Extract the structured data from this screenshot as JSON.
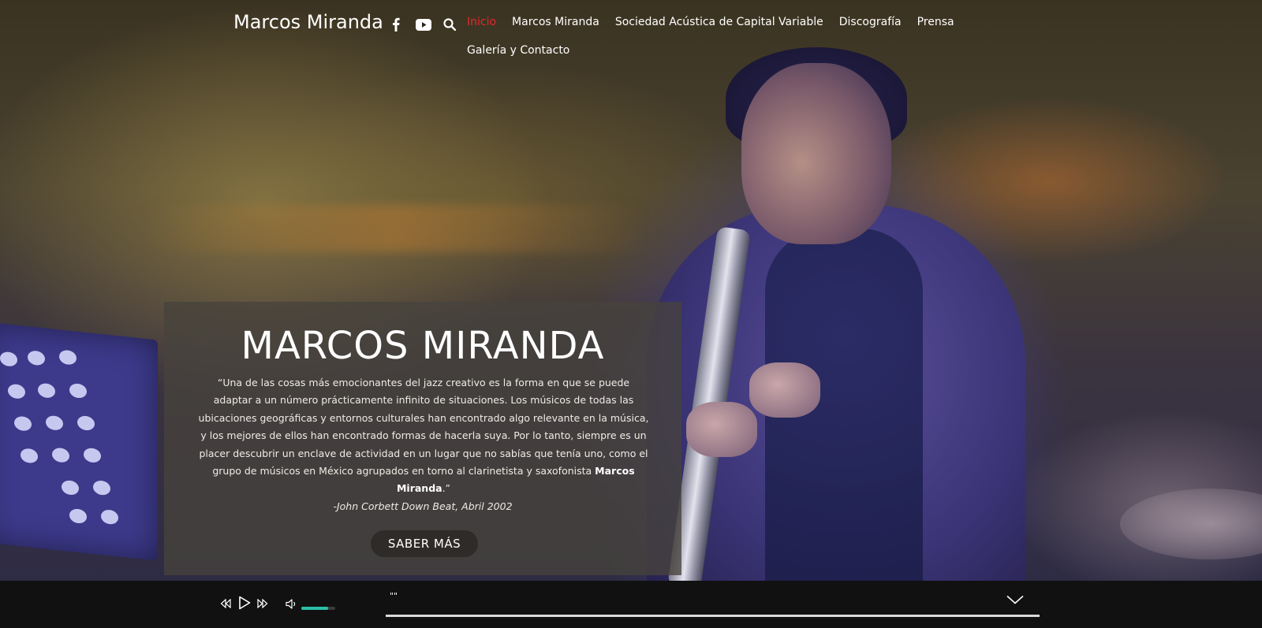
{
  "header": {
    "site_title": "Marcos Miranda",
    "social_icons": [
      "facebook-icon",
      "youtube-icon",
      "search-icon"
    ]
  },
  "nav": {
    "items": [
      {
        "label": "Inicio",
        "active": true
      },
      {
        "label": "Marcos Miranda",
        "active": false
      },
      {
        "label": "Sociedad Acústica de Capital Variable",
        "active": false
      },
      {
        "label": "Discografía",
        "active": false
      },
      {
        "label": "Prensa",
        "active": false
      },
      {
        "label": "Galería y Contacto",
        "active": false
      }
    ],
    "active_color": "#e8262e"
  },
  "hero": {
    "title": "MARCOS MIRANDA",
    "quote_text": "“Una de las cosas más emocionantes del jazz creativo es la forma en que se puede adaptar a un número prácticamente infinito de situaciones. Los músicos de todas las ubicaciones geográficas y entornos culturales han encontrado algo relevante en la música, y los mejores de ellos han encontrado formas de hacerla suya. Por lo tanto, siempre es un placer descubrir un enclave de actividad en un lugar que no sabías que tenía uno, como el grupo de músicos en México agrupados en torno al clarinetista y saxofonista ",
    "quote_highlight": "Marcos Miranda",
    "quote_end": ".”",
    "citation": "-John Corbett Down Beat, Abril 2002",
    "button_label": "SABER MÁS"
  },
  "player": {
    "track_title": "\"\"",
    "volume_level": 0.8,
    "progress": 1.0,
    "accent_color": "#2bbfa7",
    "icons": [
      "previous-icon",
      "play-icon",
      "next-icon",
      "volume-icon",
      "chevron-down-icon"
    ]
  }
}
